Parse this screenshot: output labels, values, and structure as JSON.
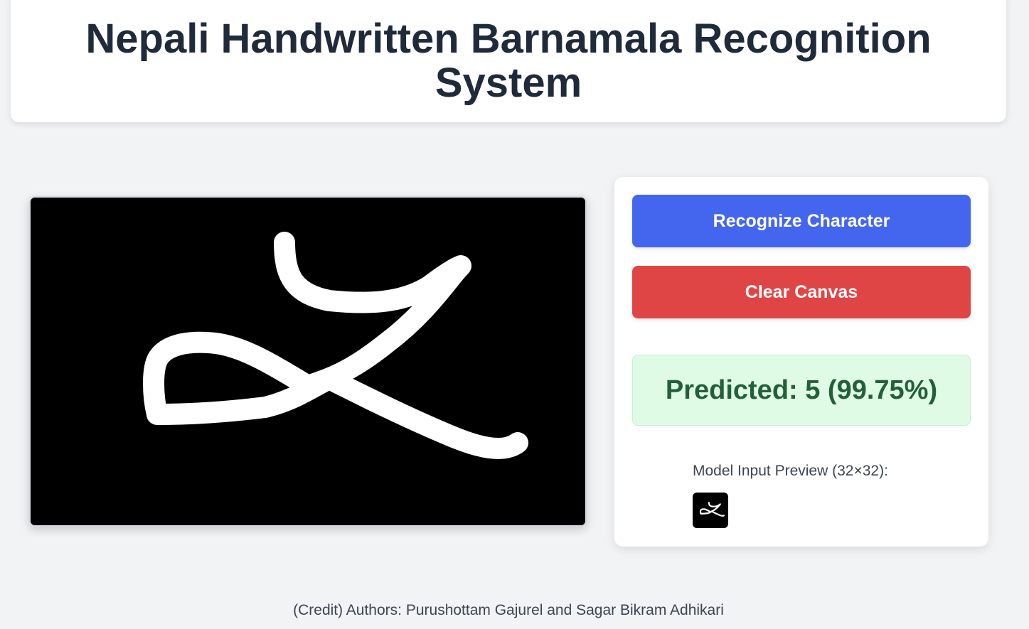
{
  "header": {
    "title": "Nepali Handwritten Barnamala Recognition System"
  },
  "canvas": {
    "background": "#000000",
    "stroke_color": "#ffffff"
  },
  "controls": {
    "recognize_label": "Recognize Character",
    "clear_label": "Clear Canvas",
    "recognize_color": "#4466ee",
    "clear_color": "#e04545"
  },
  "prediction": {
    "text": "Predicted: 5 (99.75%)",
    "background": "#dffbe6",
    "color": "#23603a"
  },
  "preview": {
    "label": "Model Input Preview (32×32):"
  },
  "footer": {
    "credit": "(Credit) Authors: Purushottam Gajurel and Sagar Bikram Adhikari"
  }
}
